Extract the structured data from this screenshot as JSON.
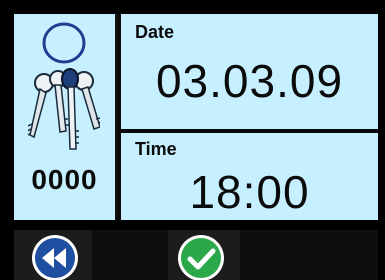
{
  "keys_panel": {
    "icon": "keys-icon",
    "code": "0000"
  },
  "date_panel": {
    "label": "Date",
    "value": "03.03.09"
  },
  "time_panel": {
    "label": "Time",
    "value": "18:00"
  },
  "toolbar": {
    "back_icon": "rewind-icon",
    "confirm_icon": "checkmark-icon"
  },
  "colors": {
    "panel_background": "#c6f0ff",
    "back_button": "#1f4fa0",
    "confirm_button": "#2aa84a"
  }
}
